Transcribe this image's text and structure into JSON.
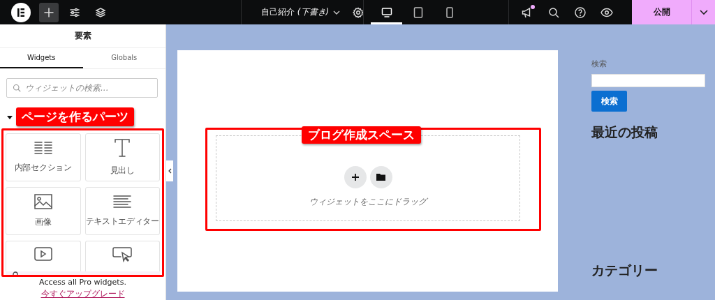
{
  "topbar": {
    "tools": [
      {
        "kind": "add",
        "selected": true
      },
      {
        "kind": "settings",
        "selected": false
      },
      {
        "kind": "layers",
        "selected": false
      }
    ],
    "document_title": "自己紹介 *(下書き)*",
    "devices": [
      {
        "kind": "desktop",
        "selected": true
      },
      {
        "kind": "tablet",
        "selected": false
      },
      {
        "kind": "mobile",
        "selected": false
      }
    ],
    "has_notification": true,
    "publish": "公開"
  },
  "panel": {
    "title": "要素",
    "tabs": [
      {
        "label": "Widgets",
        "selected": true
      },
      {
        "label": "Globals",
        "selected": false
      }
    ],
    "search": {
      "placeholder": "ウィジェットの検索..."
    },
    "category_expanded": true,
    "widgets_annotation": "ページを作るパーツ",
    "widgets": [
      {
        "kind": "section",
        "label": "内部セクション"
      },
      {
        "kind": "heading",
        "label": "見出し"
      },
      {
        "kind": "image",
        "label": "画像"
      },
      {
        "kind": "text",
        "label": "テキストエディター"
      },
      {
        "kind": "video"
      },
      {
        "kind": "button"
      }
    ],
    "promo": {
      "text": "Access all Pro widgets.",
      "link": "今すぐアップグレード"
    }
  },
  "canvas": {
    "drop_zone": {
      "annotation": "ブログ作成スペース",
      "hint": "ウィジェットをここにドラッグ"
    },
    "sidebar": {
      "search_label": "検索",
      "search_button": "検索",
      "headings": [
        "最近の投稿",
        "カテゴリー"
      ]
    }
  }
}
